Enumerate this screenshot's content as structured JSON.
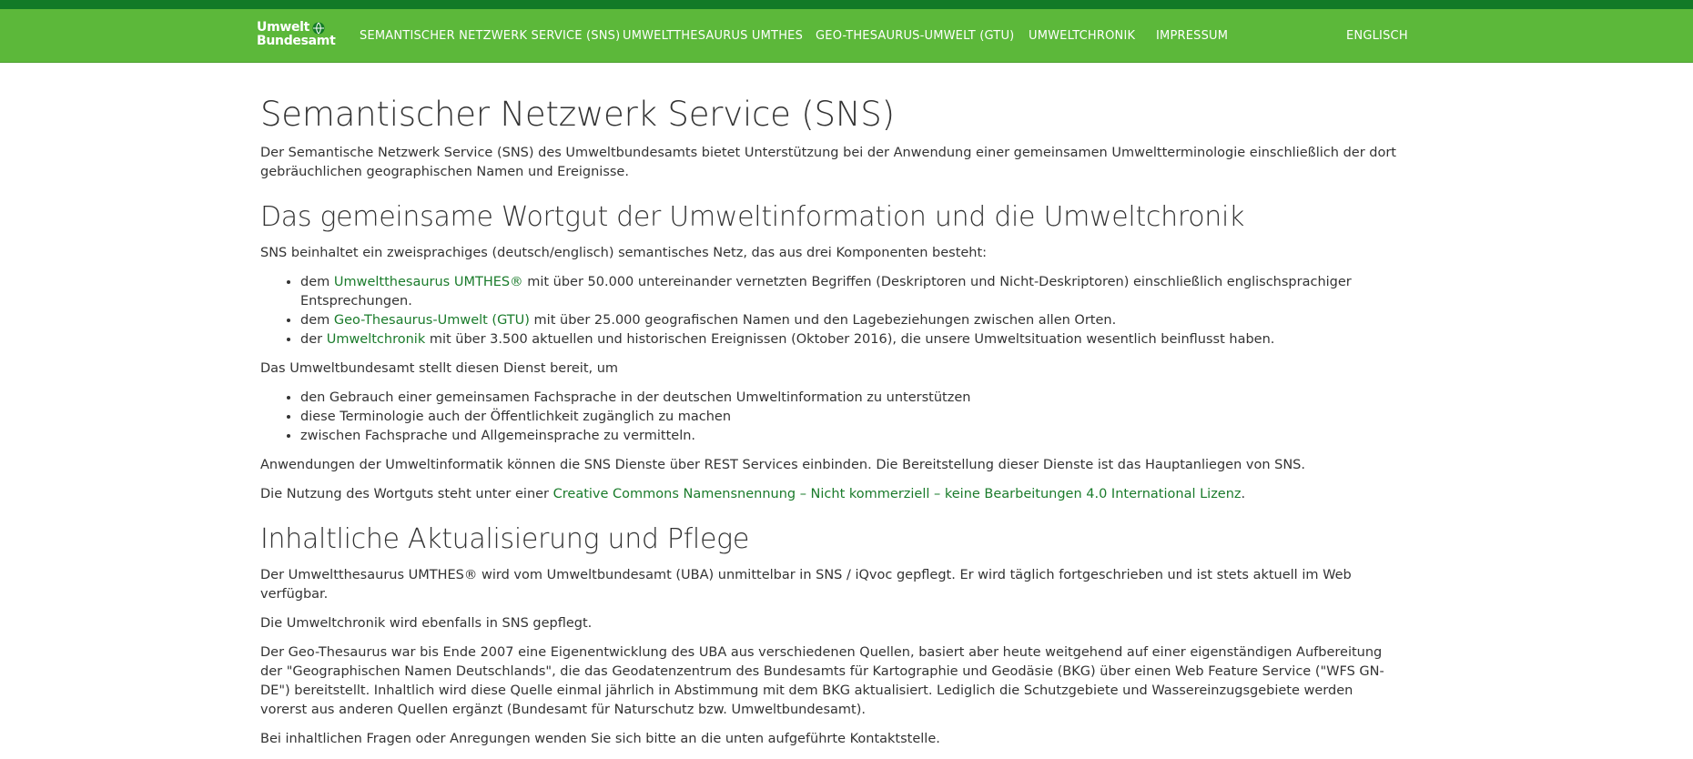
{
  "nav": {
    "logo_line1": "Umwelt",
    "logo_line2": "Bundesamt",
    "items": [
      {
        "label": "SEMANTISCHER NETZWERK SERVICE (SNS)"
      },
      {
        "label": "UMWELTTHESAURUS UMTHES"
      },
      {
        "label": "GEO-THESAURUS-UMWELT (GTU)"
      },
      {
        "label": "UMWELTCHRONIK"
      },
      {
        "label": "IMPRESSUM"
      }
    ],
    "language": "ENGLISCH"
  },
  "main": {
    "title": "Semantischer Netzwerk Service (SNS)",
    "intro": "Der Semantische Netzwerk Service (SNS) des Umweltbundesamts bietet Unterstützung bei der Anwendung einer gemeinsamen Umweltterminologie einschließlich der dort gebräuchlichen geographischen Namen und Ereignisse.",
    "section1": {
      "heading": "Das gemeinsame Wortgut der Umweltinformation und die Umweltchronik",
      "lead": "SNS beinhaltet ein zweisprachiges (deutsch/englisch) semantisches Netz, das aus drei Komponenten besteht:",
      "components": [
        {
          "prefix": "dem ",
          "link": "Umweltthesaurus UMTHES®",
          "suffix": " mit über 50.000 untereinander vernetzten Begriffen (Deskriptoren und Nicht-Deskriptoren) einschließlich englischsprachiger Entsprechungen."
        },
        {
          "prefix": "dem ",
          "link": "Geo-Thesaurus-Umwelt (GTU)",
          "suffix": " mit über 25.000 geografischen Namen und den Lagebeziehungen zwischen allen Orten."
        },
        {
          "prefix": "der ",
          "link": "Umweltchronik",
          "suffix": " mit über 3.500 aktuellen und historischen Ereignissen (Oktober 2016), die unsere Umweltsituation wesentlich beinflusst haben."
        }
      ],
      "purpose_lead": "Das Umweltbundesamt stellt diesen Dienst bereit, um",
      "purposes": [
        "den Gebrauch einer gemeinsamen Fachsprache in der deutschen Umweltinformation zu unterstützen",
        "diese Terminologie auch der Öffentlichkeit zugänglich zu machen",
        "zwischen Fachsprache und Allgemeinsprache zu vermitteln."
      ],
      "rest_text": "Anwendungen der Umweltinformatik können die SNS Dienste über REST Services einbinden. Die Bereitstellung dieser Dienste ist das Hauptanliegen von SNS.",
      "license_prefix": "Die Nutzung des Wortguts steht unter einer ",
      "license_link": "Creative Commons Namensnennung – Nicht kommerziell – keine Bearbeitungen 4.0 International Lizenz",
      "license_suffix": "."
    },
    "section2": {
      "heading": "Inhaltliche Aktualisierung und Pflege",
      "p1": "Der Umweltthesaurus UMTHES® wird vom Umweltbundesamt (UBA) unmittelbar in SNS / iQvoc gepflegt. Er wird täglich fortgeschrieben und ist stets aktuell im Web verfügbar.",
      "p2": "Die Umweltchronik wird ebenfalls in SNS gepflegt.",
      "p3": "Der Geo-Thesaurus war bis Ende 2007 eine Eigenentwicklung des UBA aus verschiedenen Quellen, basiert aber heute weitgehend auf einer eigenständigen Aufbereitung der \"Geographischen Namen Deutschlands\", die das Geodatenzentrum des Bundesamts für Kartographie und Geodäsie (BKG) über einen Web Feature Service (\"WFS GN-DE\") bereitstellt. Inhaltlich wird diese Quelle einmal jährlich in Abstimmung mit dem BKG aktualisiert. Lediglich die Schutzgebiete und Wassereinzugsgebiete werden vorerst aus anderen Quellen ergänzt (Bundesamt für Naturschutz bzw. Umweltbundesamt).",
      "p4": "Bei inhaltlichen Fragen oder Anregungen wenden Sie sich bitte an die unten aufgeführte Kontaktstelle."
    }
  },
  "colors": {
    "nav_green": "#5cb83a",
    "top_stripe": "#127a27",
    "link_green": "#1a7b2b"
  },
  "icons": {
    "logo_mark": "globe-icon"
  }
}
